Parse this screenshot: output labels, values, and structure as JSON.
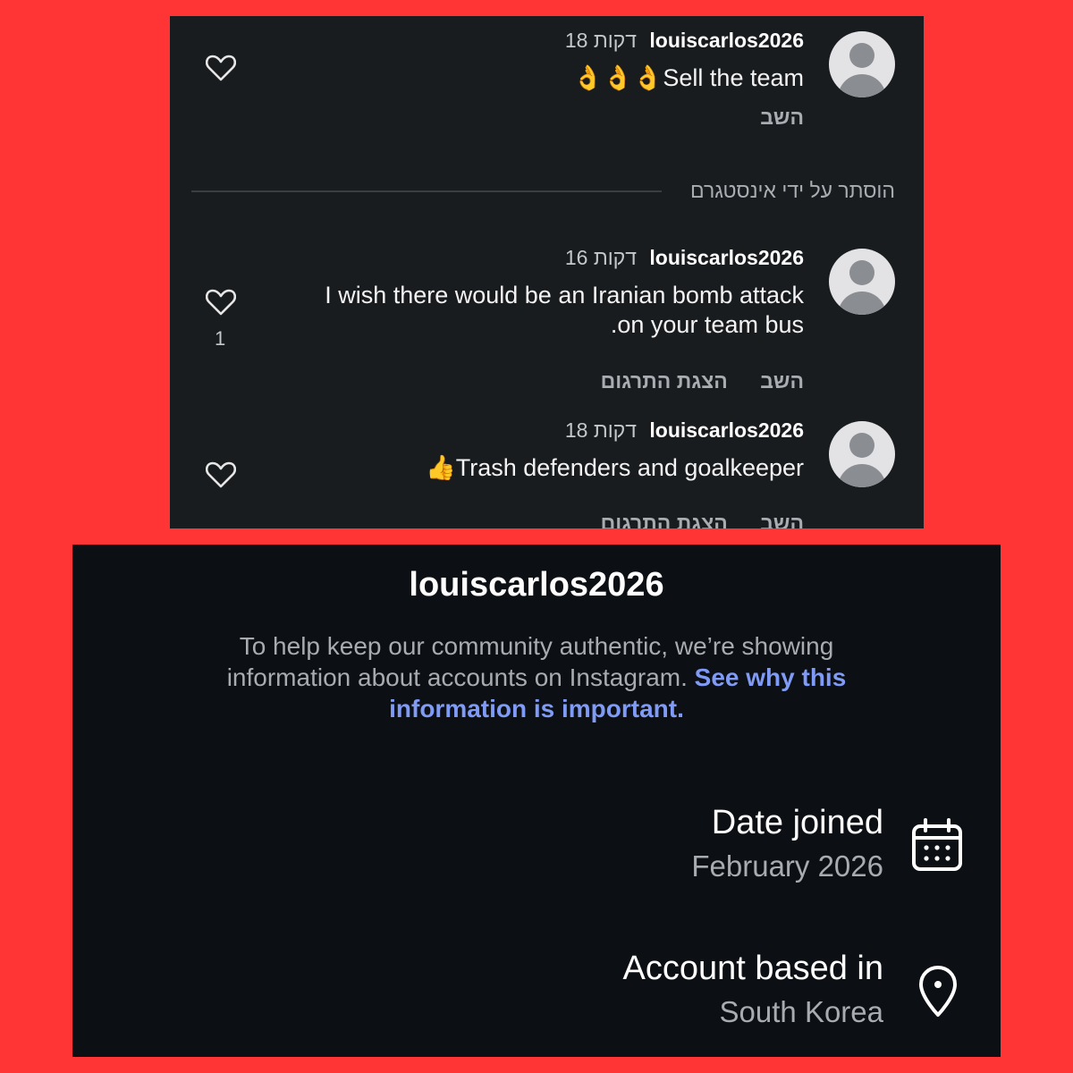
{
  "comments": [
    {
      "username": "louiscarlos2026",
      "time": "18 דקות",
      "text": "Sell the team",
      "emoji": "👌👌👌",
      "actions": [
        "השב"
      ],
      "likes": ""
    },
    {
      "username": "louiscarlos2026",
      "time": "16 דקות",
      "text_line1": "I wish there would be an Iranian bomb attack",
      "text_line2": ".on your team bus",
      "actions": [
        "השב",
        "הצגת התרגום"
      ],
      "likes": "1"
    },
    {
      "username": "louiscarlos2026",
      "time": "18 דקות",
      "text": "Trash defenders and goalkeeper",
      "emoji": "👍",
      "actions": [
        "השב",
        "הצגת התרגום"
      ],
      "likes": ""
    }
  ],
  "hidden_notice": "הוסתר על ידי אינסטגרם",
  "account": {
    "username": "louiscarlos2026",
    "description": "To help keep our community authentic, we’re showing information about accounts on Instagram.",
    "link_text": "See why this information is important.",
    "date_joined_label": "Date joined",
    "date_joined_value": "February 2026",
    "based_in_label": "Account based in",
    "based_in_value": "South Korea"
  },
  "icons": {
    "avatar": "avatar-icon",
    "like": "heart-icon",
    "calendar": "calendar-icon",
    "location": "location-pin-icon"
  },
  "colors": {
    "page_bg": "#ff3434",
    "comments_bg": "#191c1f",
    "account_bg": "#0c0f14",
    "link": "#7f9bf5"
  }
}
